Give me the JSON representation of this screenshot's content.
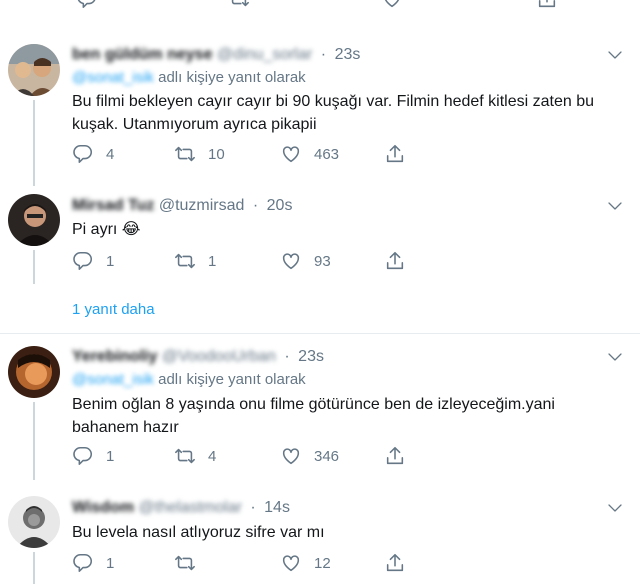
{
  "tweets": [
    {
      "name": "ben güldüm neyse",
      "handle": "@dinu_sorlar",
      "time": "23s",
      "reply_prefix": "@sonat_isik",
      "reply_suffix": "adlı kişiye yanıt olarak",
      "text": "Bu filmi bekleyen cayır cayır bi 90 kuşağı var. Filmin hedef kitlesi zaten bu kuşak. Utanmıyorum ayrıca pikapii",
      "replies": "4",
      "retweets": "10",
      "likes": "463"
    },
    {
      "name": "Mirsad Tuz",
      "handle": "@tuzmirsad",
      "time": "20s",
      "text": "Pi ayrı 😂",
      "replies": "1",
      "retweets": "1",
      "likes": "93"
    },
    {
      "name": "Yerebinoliy",
      "handle": "@VoodooUrban",
      "time": "23s",
      "reply_prefix": "@sonat_isik",
      "reply_suffix": "adlı kişiye yanıt olarak",
      "text": "Benim oğlan 8 yaşında onu filme götürünce ben de izleyeceğim.yani bahanem hazır",
      "replies": "1",
      "retweets": "4",
      "likes": "346"
    },
    {
      "name": "Wisdom",
      "handle": "@thelastmolar",
      "time": "14s",
      "text": "Bu levela nasıl atlıyoruz sifre var mı",
      "replies": "1",
      "retweets": "",
      "likes": "12"
    }
  ],
  "more_replies": "1 yanıt daha",
  "colors": {
    "accent": "#1da1f2",
    "muted": "#657786",
    "text": "#14171a",
    "line": "#ccd6dd"
  },
  "icons": [
    "reply-icon",
    "retweet-icon",
    "like-icon",
    "share-icon",
    "caret-down-icon"
  ]
}
